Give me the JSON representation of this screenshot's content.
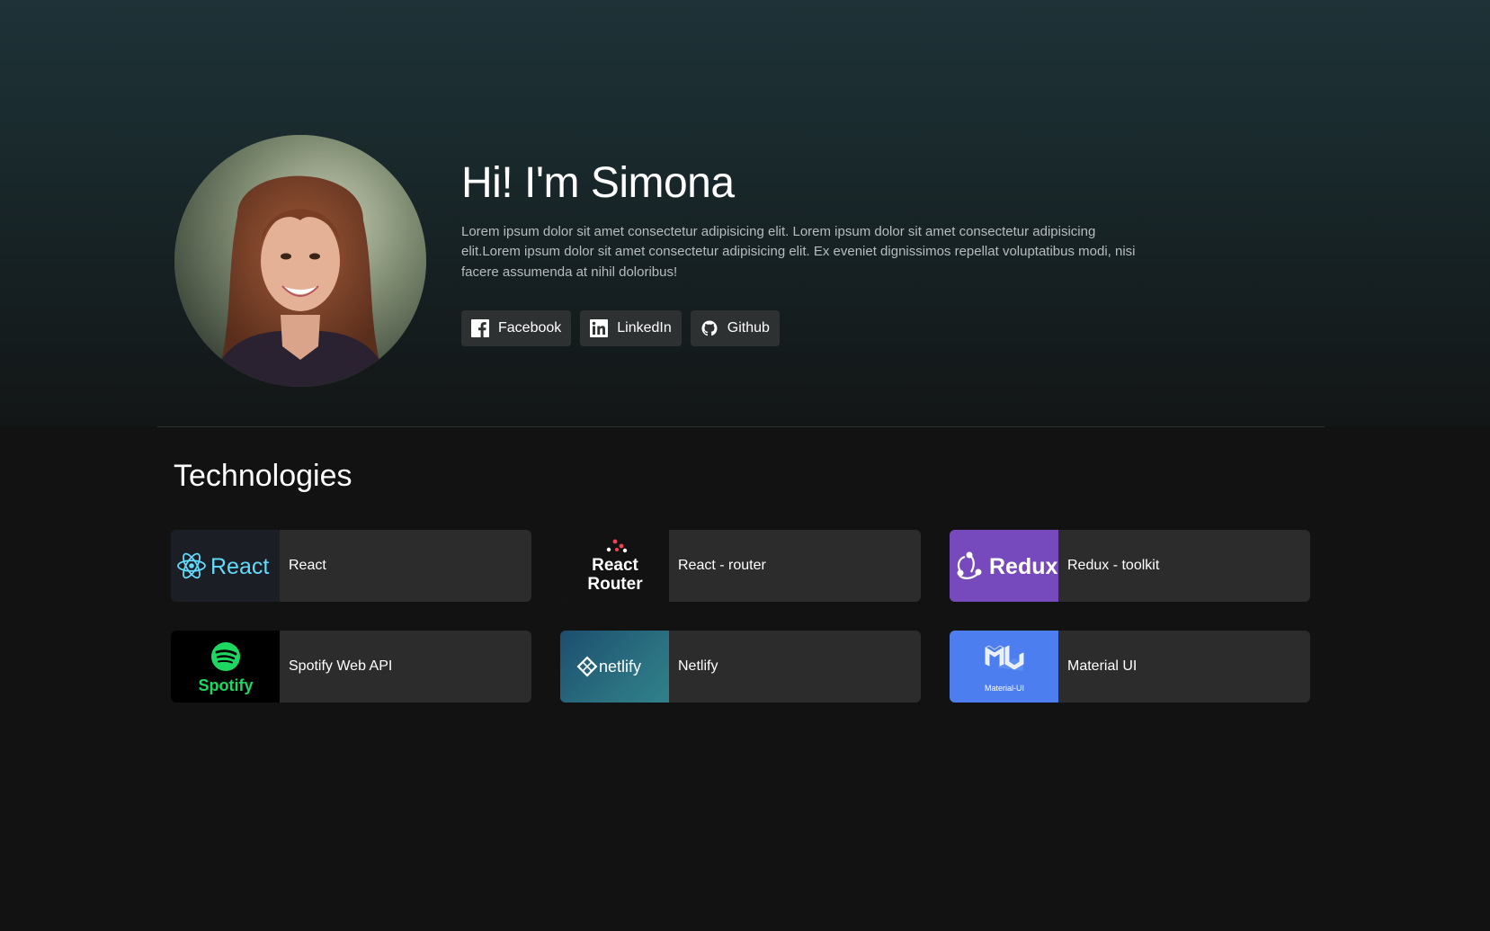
{
  "hero": {
    "title": "Hi! I'm Simona",
    "description": "Lorem ipsum dolor sit amet consectetur adipisicing elit. Lorem ipsum dolor sit amet consectetur adipisicing elit.Lorem ipsum dolor sit amet consectetur adipisicing elit. Ex eveniet dignissimos repellat voluptatibus modi, nisi facere assumenda at nihil doloribus!",
    "social": [
      {
        "label": "Facebook",
        "icon": "facebook-icon"
      },
      {
        "label": "LinkedIn",
        "icon": "linkedin-icon"
      },
      {
        "label": "Github",
        "icon": "github-icon"
      }
    ]
  },
  "technologies": {
    "title": "Technologies",
    "items": [
      {
        "label": "React",
        "logo": "react-logo",
        "logo_text": "React"
      },
      {
        "label": "React - router",
        "logo": "react-router-logo",
        "logo_text_1": "React",
        "logo_text_2": "Router"
      },
      {
        "label": "Redux - toolkit",
        "logo": "redux-logo",
        "logo_text": "Redux"
      },
      {
        "label": "Spotify Web API",
        "logo": "spotify-logo",
        "logo_text": "Spotify"
      },
      {
        "label": "Netlify",
        "logo": "netlify-logo",
        "logo_text": "netlify"
      },
      {
        "label": "Material UI",
        "logo": "material-ui-logo",
        "logo_text": "Material-UI"
      }
    ]
  },
  "colors": {
    "background": "#121212",
    "card": "#2c2c2c",
    "button": "#2e3132",
    "react": "#61dafb",
    "redux": "#764abc",
    "spotify": "#1ed760",
    "material_ui": "#4c7ef0"
  }
}
